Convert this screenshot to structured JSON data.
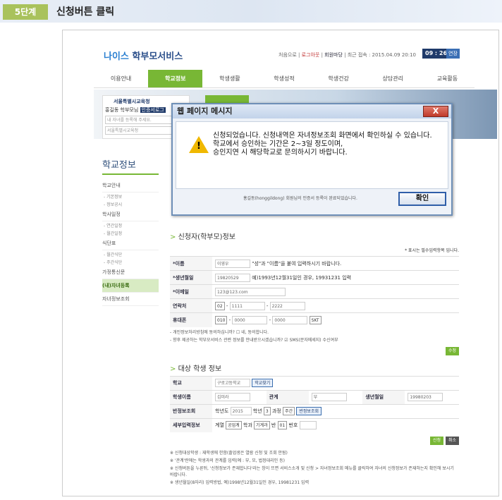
{
  "step": {
    "badge": "5단계",
    "title": "신청버튼 클릭"
  },
  "site": {
    "logo_nais": "나이스",
    "logo_rest": "학부모서비스"
  },
  "toplinks": {
    "home": "처음으로",
    "logout": "로그아웃",
    "mypage": "회원마당",
    "last_login": "최근 접속 : 2015.04.09 20:10",
    "time": "09 : 26",
    "extend": "연장"
  },
  "nav": [
    "이용안내",
    "학교정보",
    "학생생활",
    "학생성적",
    "학생건강",
    "상담관리",
    "교육활동"
  ],
  "userbox": {
    "org": "서울특별시교육청",
    "name": "홍길동 학부모님",
    "badge": "인증서로그",
    "input1": "내 자녀를 등록해 주세요.",
    "input2": "서울특별시교육청"
  },
  "sidebar": {
    "title": "학교정보",
    "items": [
      "학교안내",
      "- 기본정보",
      "- 정보공시",
      "학사일정",
      "- 연간일정",
      "- 월간일정",
      "식단표",
      "- 월간식단",
      "- 주간식단",
      "가정통신문",
      "(내)자녀등록",
      "자녀정보조회"
    ]
  },
  "form": {
    "sec1": "신청자(학부모)정보",
    "req": "* 표시는 필수입력항목 입니다.",
    "name_lbl": "*이름",
    "name_val": "이영우",
    "name_hint": "\"성\"과 \"이름\"을 붙여 입력하시기 바랍니다.",
    "birth_lbl": "*생년월일",
    "birth_val": "19820529",
    "birth_hint": "예)1993년12월31일인 경우, 19931231 입력",
    "email_lbl": "*이메일",
    "email_val": "123@123.com",
    "tel_lbl": "연락처",
    "tel1": "02",
    "tel2": "1111",
    "tel3": "2222",
    "mob_lbl": "휴대폰",
    "mob1": "010",
    "mob2": "0000",
    "mob3": "0000",
    "mob4": "SKT",
    "agree1": "- 개인정보처리방침에 동의하십니까?",
    "agree1b": "네, 동의합니다.",
    "agree2": "- 향후 제공하는 학부모서비스 관련 정보를 안내받으시겠습니까?",
    "agree2b": "SMS(문자메세지) 수신여부",
    "edit": "수정",
    "sec2": "대상 학생 정보",
    "school_lbl": "학교",
    "school_val": "구로고등학교",
    "school_btn": "학교찾기",
    "sname_lbl": "학생이름",
    "sname_val": "김미라",
    "rel_lbl": "관계",
    "rel_val": "부",
    "sbirth_lbl": "생년월일",
    "sbirth_val": "19980203",
    "class_lbl": "반정보조회",
    "year_lbl": "학년도",
    "year_val": "2015",
    "grade_val": "3",
    "grade_lbl": "학년",
    "track_lbl": "과정",
    "track_val": "주간",
    "class_btn": "반정보조회",
    "detail_lbl": "세부입력정보",
    "div_lbl": "계열",
    "div_val": "공업계",
    "dept_lbl": "학과",
    "dept_val": "기계과",
    "ban_lbl": "반",
    "ban_val": "01",
    "num_lbl": "번호",
    "apply": "신청",
    "cancel": "취소",
    "notes": [
      "※ 신청대상학생 : 재학생에 한함(졸업생은 열람 신청 및 조회 안됨)",
      "※ '관계'란에는 학생과의 관계를 입력(예 : 부, 모, 법정대리인 등)",
      "※ 신청버튼을 누른뒤, '신청정보가 존재합니다'라는 창이 뜨면 서비스소개 및 신청 > 자녀정보조회 메뉴를 클릭하여 자녀의 신청정보가 존재하는지 확인해 보시기 바랍니다.",
      "※ 생년월일(8자리) 입력방법, 예)1998년12월31일인 경우, 19981231 입력"
    ]
  },
  "dialog": {
    "title": "웹 페이지 메시지",
    "close": "X",
    "line1": "신청되었습니다. 신청내역은 자녀정보조회 화면에서 확인하실 수 있습니다.",
    "line2": "학교에서 승인하는 기간은 2~3일 정도이며,",
    "line3": "승인지연 시 해당학교로 문의하시기 바랍니다.",
    "footnote": "홍길동(honggildong) 회원님의 인증서 등록이 완료되었습니다.",
    "ok": "확인"
  }
}
